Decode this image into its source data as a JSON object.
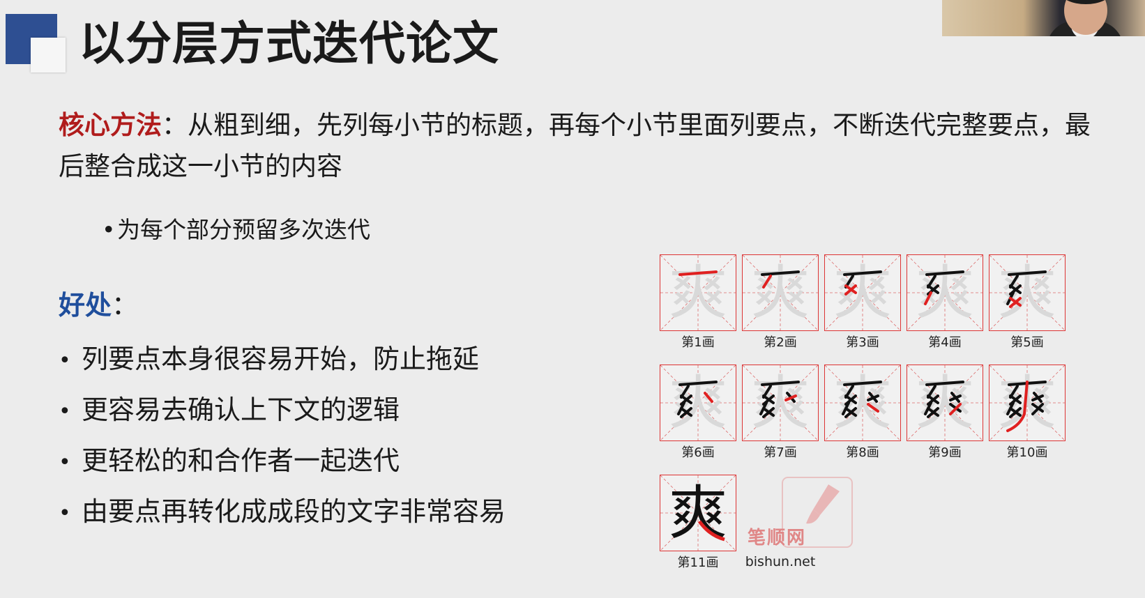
{
  "slide": {
    "title": "以分层方式迭代论文",
    "core_label": "核心方法",
    "core_text": "：从粗到细，先列每小节的标题，再每个小节里面列要点，不断迭代完整要点，最后整合成这一小节的内容",
    "sub_bullet": "为每个部分预留多次迭代",
    "benefits_label": "好处",
    "benefits_colon": "：",
    "benefits": [
      "列要点本身很容易开始，防止拖延",
      "更容易去确认上下文的逻辑",
      "更轻松的和合作者一起迭代",
      "由要点再转化成成段的文字非常容易"
    ],
    "bullet_symbol": "•"
  },
  "strokes": {
    "character": "爽",
    "labels": [
      "第1画",
      "第2画",
      "第3画",
      "第4画",
      "第5画",
      "第6画",
      "第7画",
      "第8画",
      "第9画",
      "第10画",
      "第11画"
    ],
    "watermark_text": "笔顺网",
    "site": "bishun.net",
    "highlight_color": "#e02020",
    "grid_color": "#d33333"
  }
}
